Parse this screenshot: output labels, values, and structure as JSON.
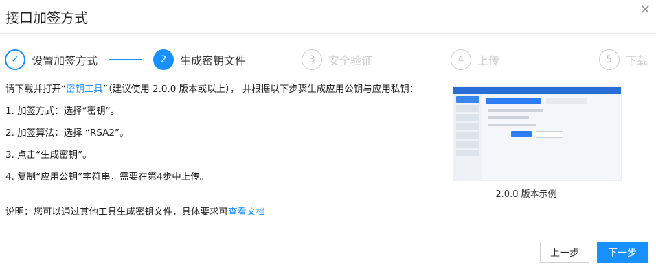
{
  "dialog": {
    "title": "接口加签方式"
  },
  "steps": [
    {
      "index": "✓",
      "label": "设置加签方式",
      "state": "done"
    },
    {
      "index": "2",
      "label": "生成密钥文件",
      "state": "active"
    },
    {
      "index": "3",
      "label": "安全验证",
      "state": "pending"
    },
    {
      "index": "4",
      "label": "上传",
      "state": "pending"
    },
    {
      "index": "5",
      "label": "下载",
      "state": "pending"
    }
  ],
  "content": {
    "intro_pre": "请下载并打开“",
    "intro_link": "密钥工具",
    "intro_post": "”（建议使用 2.0.0 版本或以上）， 并根据以下步骤生成应用公钥与应用私钥：",
    "step1": "1. 加签方式：选择“密钥”。",
    "step2": "2. 加签算法：选择 “RSA2”。",
    "step3": "3. 点击“生成密钥”。",
    "step4": "4. 复制“应用公钥”字符串，需要在第4步中上传。",
    "note_pre": "说明：您可以通过其他工具生成密钥文件，具体要求可",
    "note_link": "查看文档"
  },
  "preview": {
    "caption": "2.0.0 版本示例"
  },
  "footer": {
    "prev_label": "上一步",
    "next_label": "下一步"
  }
}
